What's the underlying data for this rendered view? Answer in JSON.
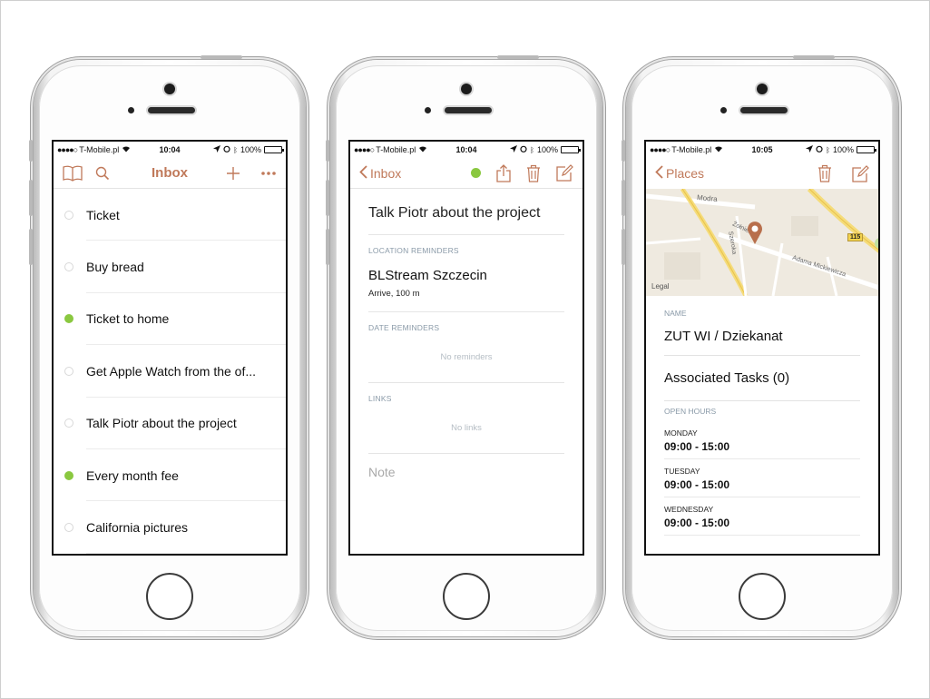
{
  "status": {
    "signal": "●●●●○",
    "carrier": "T-Mobile.pl",
    "battery": "100%"
  },
  "phones": [
    {
      "time": "10:04",
      "nav": {
        "title": "Inbox"
      },
      "tasks": [
        {
          "label": "Ticket",
          "dot": "empty"
        },
        {
          "label": "Buy bread",
          "dot": "empty"
        },
        {
          "label": "Ticket to home",
          "dot": "green"
        },
        {
          "label": "Get Apple Watch from the of...",
          "dot": "empty"
        },
        {
          "label": "Talk Piotr about the project",
          "dot": "empty"
        },
        {
          "label": "Every month fee",
          "dot": "green"
        },
        {
          "label": "California pictures",
          "dot": "empty"
        }
      ]
    },
    {
      "time": "10:04",
      "nav": {
        "back": "Inbox"
      },
      "title": "Talk Piotr about the project",
      "location_header": "LOCATION REMINDERS",
      "location_name": "BLStream Szczecin",
      "location_sub": "Arrive, 100 m",
      "date_header": "DATE REMINDERS",
      "date_empty": "No reminders",
      "links_header": "LINKS",
      "links_empty": "No links",
      "note_placeholder": "Note"
    },
    {
      "time": "10:05",
      "nav": {
        "back": "Places"
      },
      "map": {
        "legal": "Legal",
        "road_badge": "115",
        "streets": [
          "Modra",
          "Szeroka",
          "Żołnierska",
          "Adama Mickiewicza"
        ]
      },
      "name_header": "NAME",
      "name": "ZUT WI / Dziekanat",
      "associated": "Associated Tasks (0)",
      "hours_header": "OPEN HOURS",
      "days": [
        {
          "day": "MONDAY",
          "hours": "09:00 - 15:00"
        },
        {
          "day": "TUESDAY",
          "hours": "09:00 - 15:00"
        },
        {
          "day": "WEDNESDAY",
          "hours": "09:00 - 15:00"
        }
      ]
    }
  ],
  "colors": {
    "accent": "#c0795a",
    "green": "#8ac840",
    "section": "#8a9aa8"
  }
}
